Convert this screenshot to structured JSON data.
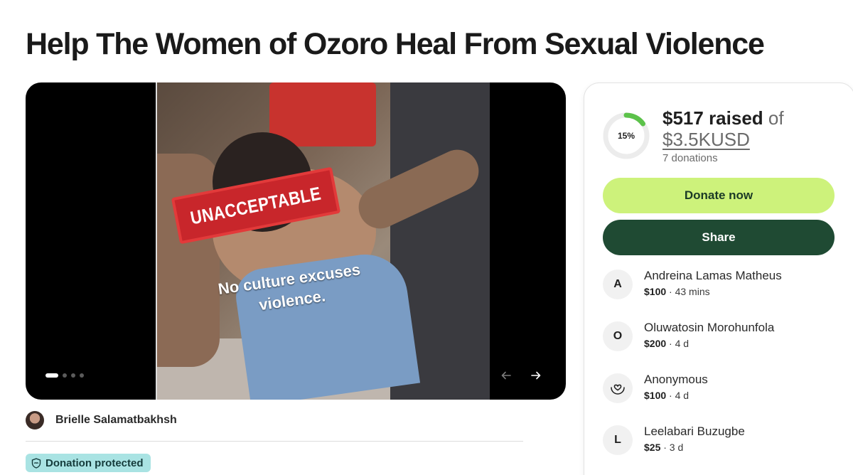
{
  "page": {
    "title": "Help The Women of Ozoro Heal From Sexual Violence"
  },
  "media": {
    "stamp_text": "UNACCEPTABLE",
    "caption_line1": "No culture excuses",
    "caption_line2": "violence.",
    "slide_count": 4,
    "active_slide": 1
  },
  "organizer": {
    "name": "Brielle Salamatbakhsh"
  },
  "badge": {
    "label": "Donation protected"
  },
  "fundraiser": {
    "progress_percent": 15,
    "progress_label": "15%",
    "raised": "$517 raised",
    "of": " of",
    "goal": "$3.5KUSD",
    "donation_count": "7 donations",
    "donate_label": "Donate now",
    "share_label": "Share",
    "accent_color": "#cdf27b",
    "share_color": "#1f4a33"
  },
  "donors": [
    {
      "initial": "A",
      "name": "Andreina Lamas Matheus",
      "amount": "$100",
      "time": " · 43 mins"
    },
    {
      "initial": "O",
      "name": "Oluwatosin Morohunfola",
      "amount": "$200",
      "time": " · 4 d"
    },
    {
      "initial": "",
      "icon": "heart-hands-icon",
      "name": "Anonymous",
      "amount": "$100",
      "time": " · 4 d"
    },
    {
      "initial": "L",
      "name": "Leelabari Buzugbe",
      "amount": "$25",
      "time": " · 3 d"
    }
  ]
}
